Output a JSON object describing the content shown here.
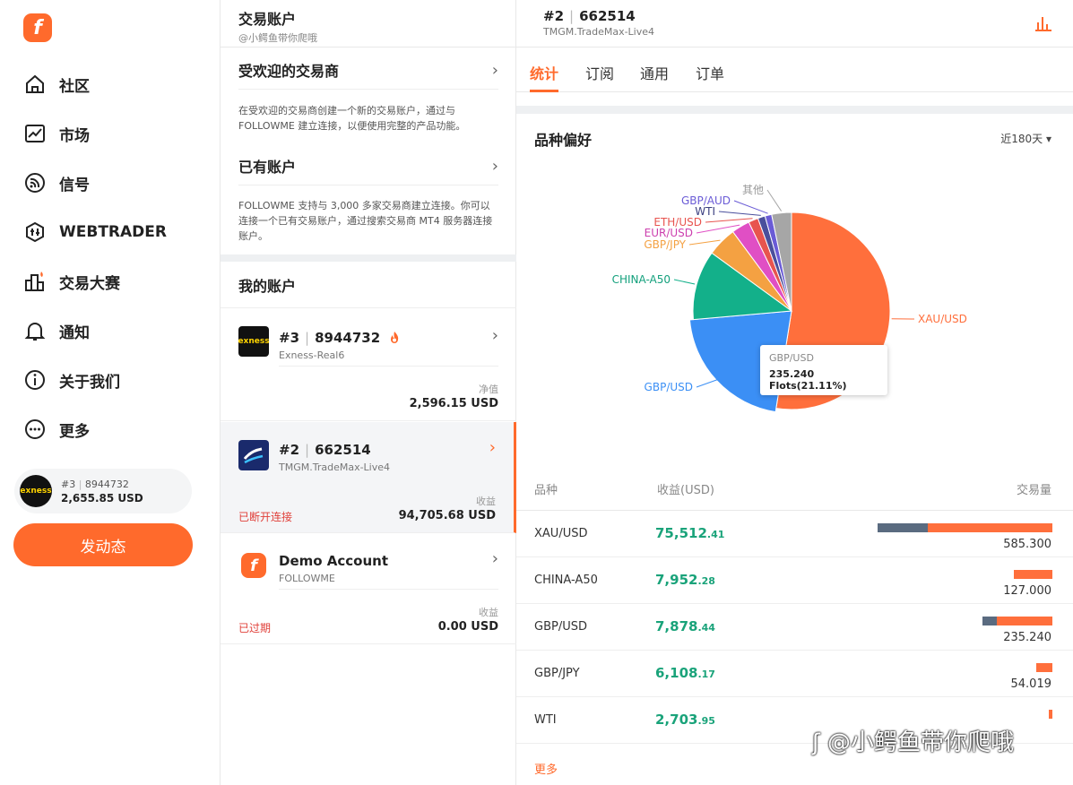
{
  "sidebar": {
    "logo": "f",
    "items": [
      {
        "label": "社区"
      },
      {
        "label": "市场"
      },
      {
        "label": "信号"
      },
      {
        "label": "WEBTRADER"
      },
      {
        "label": "交易大赛"
      },
      {
        "label": "通知"
      },
      {
        "label": "关于我们"
      },
      {
        "label": "更多"
      }
    ],
    "account": {
      "id": "#3",
      "number": "8944732",
      "balance": "2,655.85 USD",
      "avatar_text": "exness"
    },
    "post_button": "发动态"
  },
  "middle": {
    "title": "交易账户",
    "subtitle": "@小鳄鱼带你爬哦",
    "popular": {
      "title": "受欢迎的交易商",
      "desc": "在受欢迎的交易商创建一个新的交易账户，通过与 FOLLOWME 建立连接，以便使用完整的产品功能。"
    },
    "existing": {
      "title": "已有账户",
      "desc": "FOLLOWME 支持与 3,000 多家交易商建立连接。你可以连接一个已有交易账户，通过搜索交易商 MT4 服务器连接账户。"
    },
    "my_accounts": "我的账户",
    "accounts": [
      {
        "id": "#3",
        "number": "8944732",
        "server": "Exness-Real6",
        "label": "净值",
        "value": "2,596.15 USD",
        "status": "",
        "avatar": "exness"
      },
      {
        "id": "#2",
        "number": "662514",
        "server": "TMGM.TradeMax-Live4",
        "label": "收益",
        "value": "94,705.68 USD",
        "status": "已断开连接",
        "avatar": ""
      },
      {
        "id": "",
        "number": "Demo Account",
        "server": "FOLLOWME",
        "label": "收益",
        "value": "0.00 USD",
        "status": "已过期",
        "avatar": "f"
      }
    ]
  },
  "detail": {
    "id": "#2",
    "number": "662514",
    "server": "TMGM.TradeMax-Live4",
    "tabs": [
      "统计",
      "订阅",
      "通用",
      "订单"
    ],
    "pref_title": "品种偏好",
    "period": "近180天",
    "tooltip": {
      "symbol": "GBP/USD",
      "value": "235.240 Flots(21.11%)"
    },
    "table_headers": {
      "symbol": "品种",
      "pnl": "收益(USD)",
      "volume": "交易量"
    },
    "rows": [
      {
        "symbol": "XAU/USD",
        "pnl_int": "75,512",
        "pnl_dec": ".41",
        "volume": "585.300"
      },
      {
        "symbol": "CHINA-A50",
        "pnl_int": "7,952",
        "pnl_dec": ".28",
        "volume": "127.000"
      },
      {
        "symbol": "GBP/USD",
        "pnl_int": "7,878",
        "pnl_dec": ".44",
        "volume": "235.240"
      },
      {
        "symbol": "GBP/JPY",
        "pnl_int": "6,108",
        "pnl_dec": ".17",
        "volume": "54.019"
      },
      {
        "symbol": "WTI",
        "pnl_int": "2,703",
        "pnl_dec": ".95",
        "volume": ""
      }
    ],
    "more": "更多"
  },
  "chart_data": {
    "type": "pie",
    "categories": [
      "XAU/USD",
      "GBP/USD",
      "CHINA-A50",
      "GBP/JPY",
      "EUR/USD",
      "ETH/USD",
      "WTI",
      "GBP/AUD",
      "其他"
    ],
    "values": [
      52.5,
      21.11,
      11.4,
      4.85,
      3.0,
      1.6,
      1.2,
      1.1,
      3.24
    ],
    "colors": [
      "#ff6f3c",
      "#3b8ff5",
      "#13b08a",
      "#f4a142",
      "#e04fc4",
      "#e8544f",
      "#4a4f9c",
      "#6a5bd6",
      "#a6a6a6"
    ],
    "label_colors": [
      "#ff6f3c",
      "#3b8ff5",
      "#13a07c",
      "#f4a142",
      "#cc3fae",
      "#e8544f",
      "#3b3f80",
      "#6a5bd6",
      "#999999"
    ]
  },
  "watermark": "@小鳄鱼带你爬哦"
}
